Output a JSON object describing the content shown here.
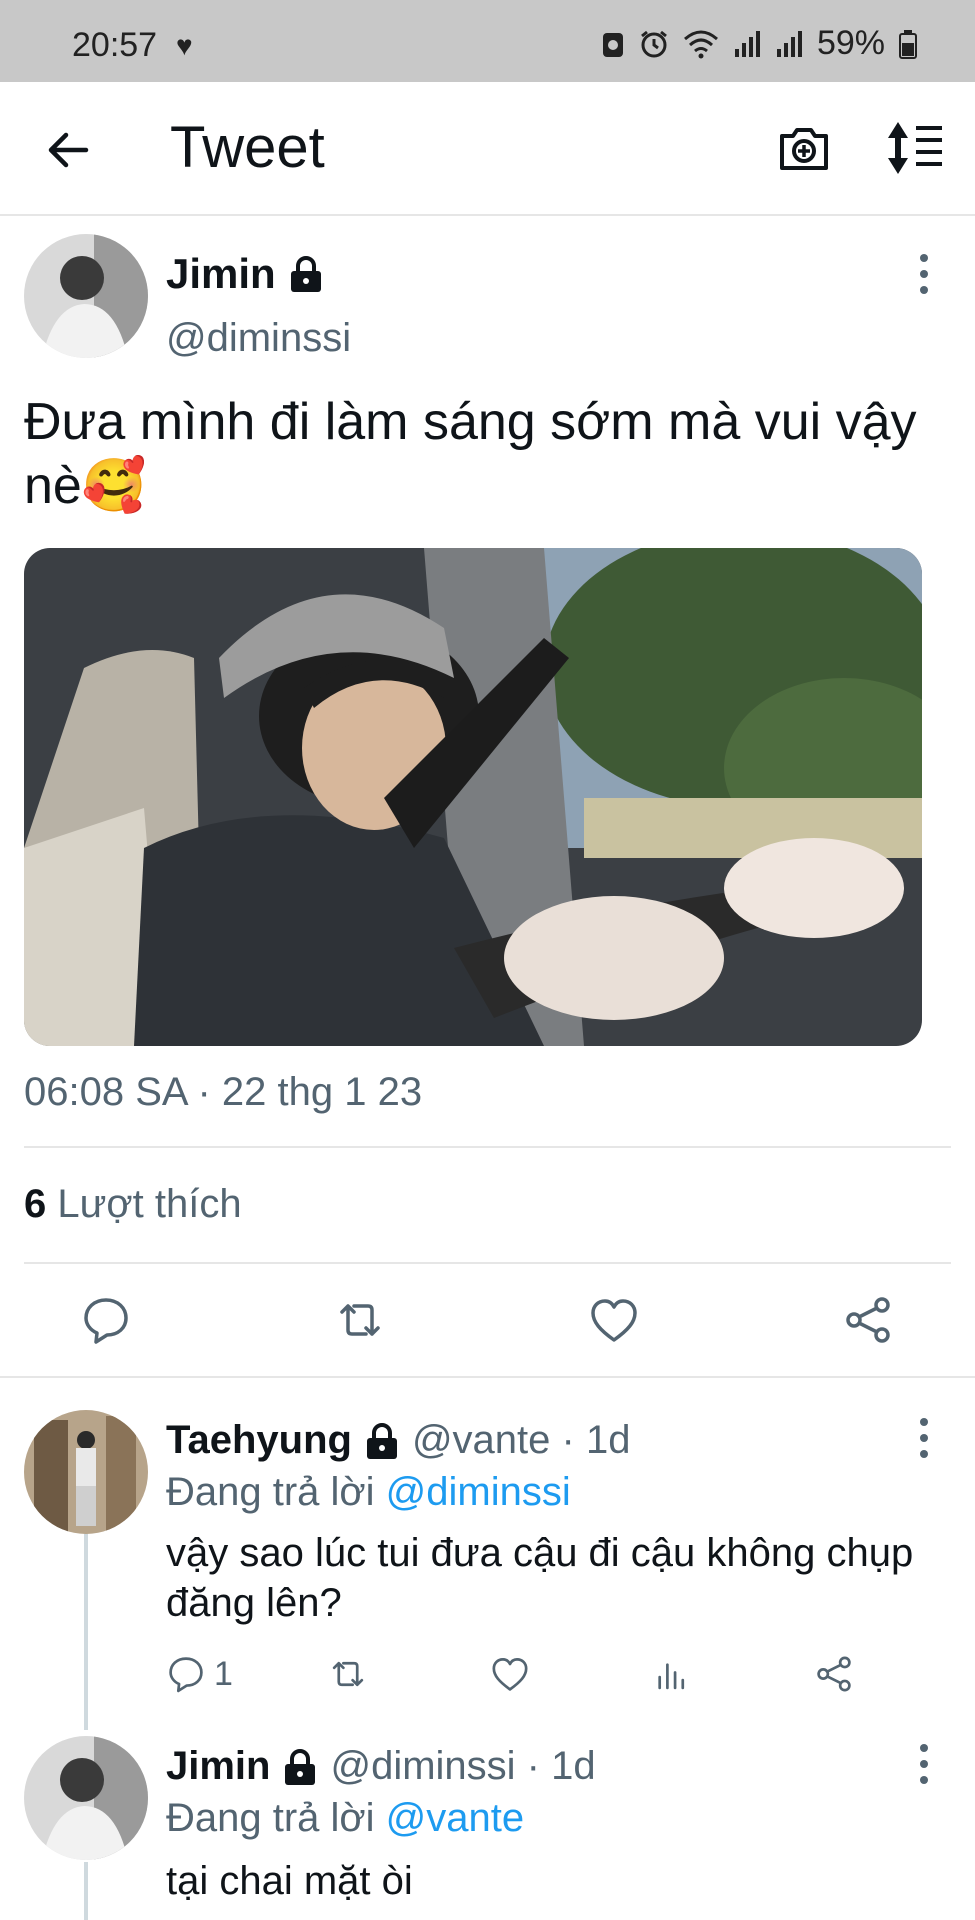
{
  "status_bar": {
    "time": "20:57",
    "battery": "59%",
    "icons": [
      "heart-icon",
      "save-icon",
      "alarm-icon",
      "wifi-icon",
      "signal-icon",
      "signal-icon",
      "battery-icon"
    ]
  },
  "header": {
    "title": "Tweet",
    "back_icon": "back-arrow-icon",
    "camera_icon": "camera-plus-icon",
    "sort_icon": "sort-icon"
  },
  "tweet": {
    "name": "Jimin",
    "handle": "@diminssi",
    "text": "Đưa mình đi làm sáng sớm mà vui vậy nè🥰",
    "timestamp": "06:08 SA · 22 thg 1 23",
    "likes_count": "6",
    "likes_label": "Lượt thích"
  },
  "replies": [
    {
      "name": "Taehyung",
      "handle_time": "@vante · 1d",
      "replying_prefix": "Đang trả lời",
      "replying_to": "@diminssi",
      "text": "vậy sao lúc tui đưa cậu đi cậu không chụp đăng lên?",
      "reply_count": "1"
    },
    {
      "name": "Jimin",
      "handle_time": "@diminssi · 1d",
      "replying_prefix": "Đang trả lời",
      "replying_to": "@vante",
      "text": "tại chai mặt òi"
    }
  ],
  "colors": {
    "status_bar_bg": "#c8c8c8",
    "text_primary": "#0f1419",
    "text_secondary": "#536471",
    "accent": "#1d9bf0",
    "divider": "#e6e6e6"
  }
}
